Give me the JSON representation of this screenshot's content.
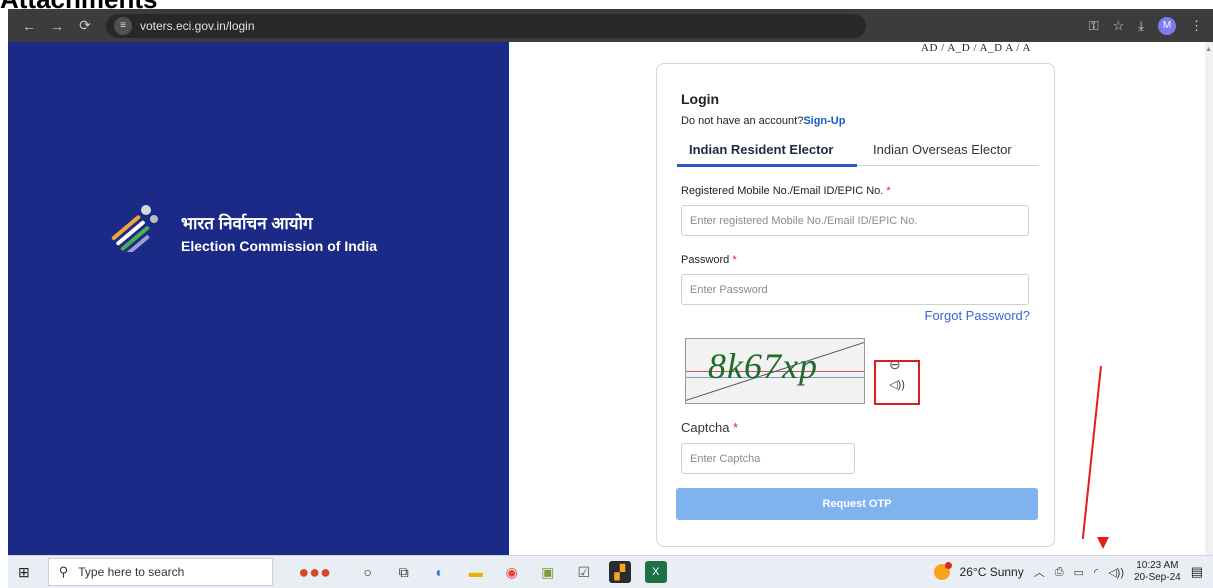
{
  "heading": "Attachments",
  "browser": {
    "url": "voters.eci.gov.in/login",
    "profile_initial": "M"
  },
  "brand": {
    "hindi_name": "भारत निर्वाचन आयोग",
    "english_name": "Election Commission of India"
  },
  "toolbar_strip_text": "AD / A_D / A_D  A / A",
  "login": {
    "title": "Login",
    "no_account_text": "Do not have an account?",
    "signup_label": "Sign-Up",
    "tabs": [
      {
        "label": "Indian Resident Elector",
        "active": true
      },
      {
        "label": "Indian Overseas Elector",
        "active": false
      }
    ],
    "mobile_label": "Registered Mobile No./Email ID/EPIC No.",
    "mobile_placeholder": "Enter registered Mobile No./Email ID/EPIC No.",
    "password_label": "Password",
    "password_placeholder": "Enter Password",
    "forgot_label": "Forgot Password?",
    "captcha_image_text": "8k67xp",
    "captcha_label": "Captcha",
    "captcha_placeholder": "Enter Captcha",
    "request_otp_label": "Request OTP",
    "required_mark": "*"
  },
  "taskbar": {
    "search_placeholder": "Type here to search",
    "weather": "26°C  Sunny",
    "time": "10:23 AM",
    "date": "20-Sep-24"
  },
  "colors": {
    "brand_panel": "#1b2a86",
    "link_blue": "#1a57c4",
    "otp_button": "#7fb3f0",
    "annotation_red": "#e61c1c"
  }
}
